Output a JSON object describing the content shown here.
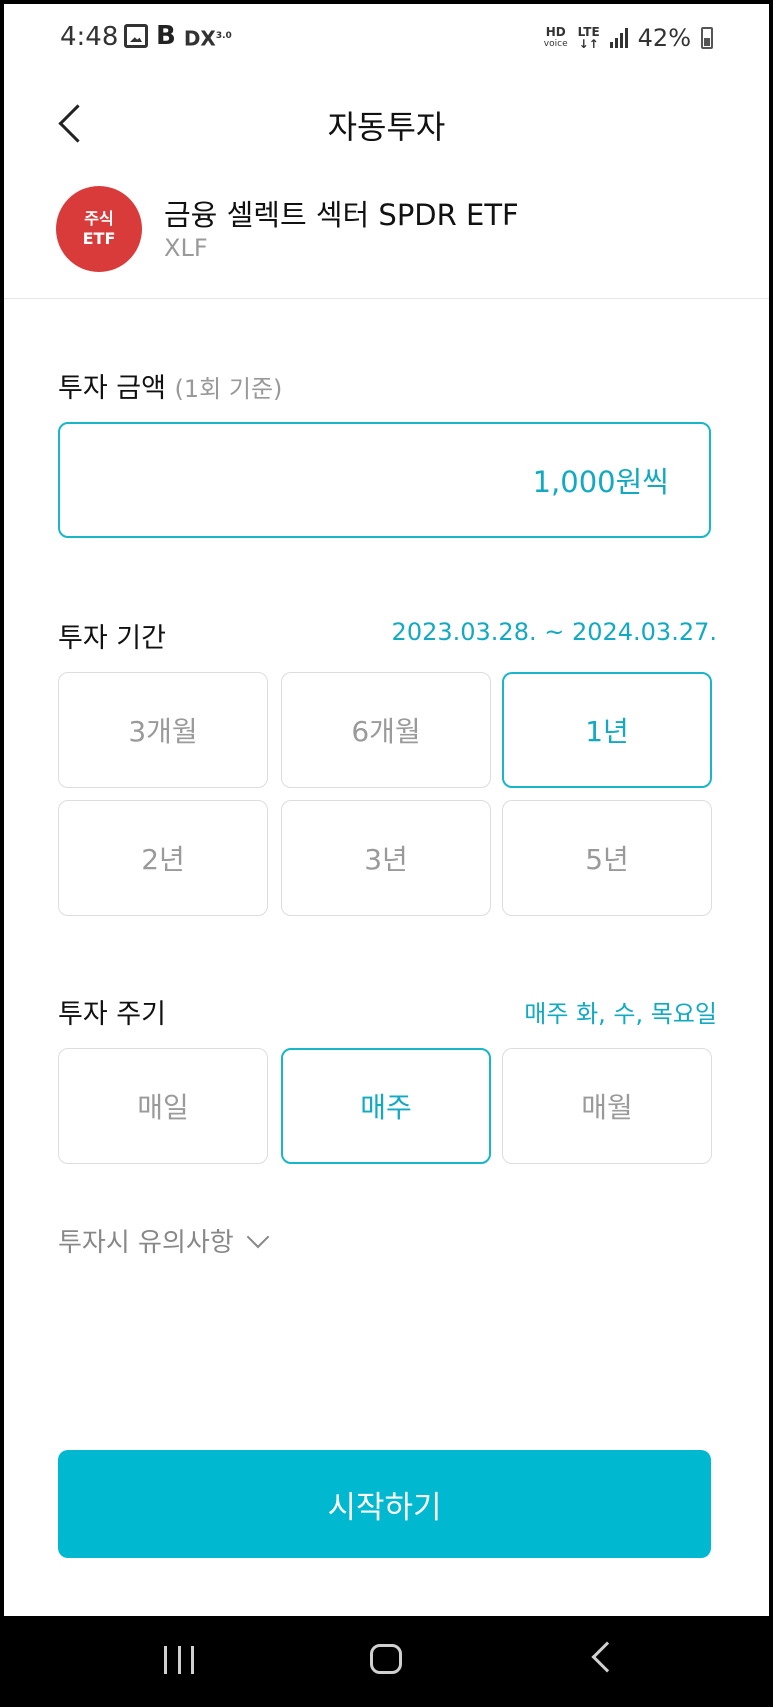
{
  "status_bar": {
    "time": "4:48",
    "left_icons": [
      "gallery-icon",
      "b-app-icon",
      "dx-icon"
    ],
    "dx_label": "DX",
    "dx_sup": "3.0",
    "b_label": "B",
    "hd_label": "HD",
    "hd_sub": "voice",
    "lte_label": "LTE",
    "lte_sub": "↓↑",
    "battery_percent": "42%"
  },
  "header": {
    "title": "자동투자"
  },
  "product": {
    "badge_line1": "주식",
    "badge_line2": "ETF",
    "badge_color": "#d93b3b",
    "name": "금융 셀렉트 섹터 SPDR ETF",
    "ticker": "XLF"
  },
  "amount": {
    "label": "투자 금액",
    "sublabel": "(1회 기준)",
    "value": "1,000원씩"
  },
  "period": {
    "label": "투자 기간",
    "range": "2023.03.28. ~ 2024.03.27.",
    "options": [
      "3개월",
      "6개월",
      "1년",
      "2년",
      "3년",
      "5년"
    ],
    "selected": "1년"
  },
  "cycle": {
    "label": "투자 주기",
    "detail": "매주 화, 수, 목요일",
    "options": [
      "매일",
      "매주",
      "매월"
    ],
    "selected": "매주"
  },
  "notice": {
    "label": "투자시 유의사항"
  },
  "start_button": {
    "label": "시작하기"
  },
  "colors": {
    "accent": "#19b5c9",
    "accent_text": "#12aac2",
    "button": "#00b8cf"
  }
}
